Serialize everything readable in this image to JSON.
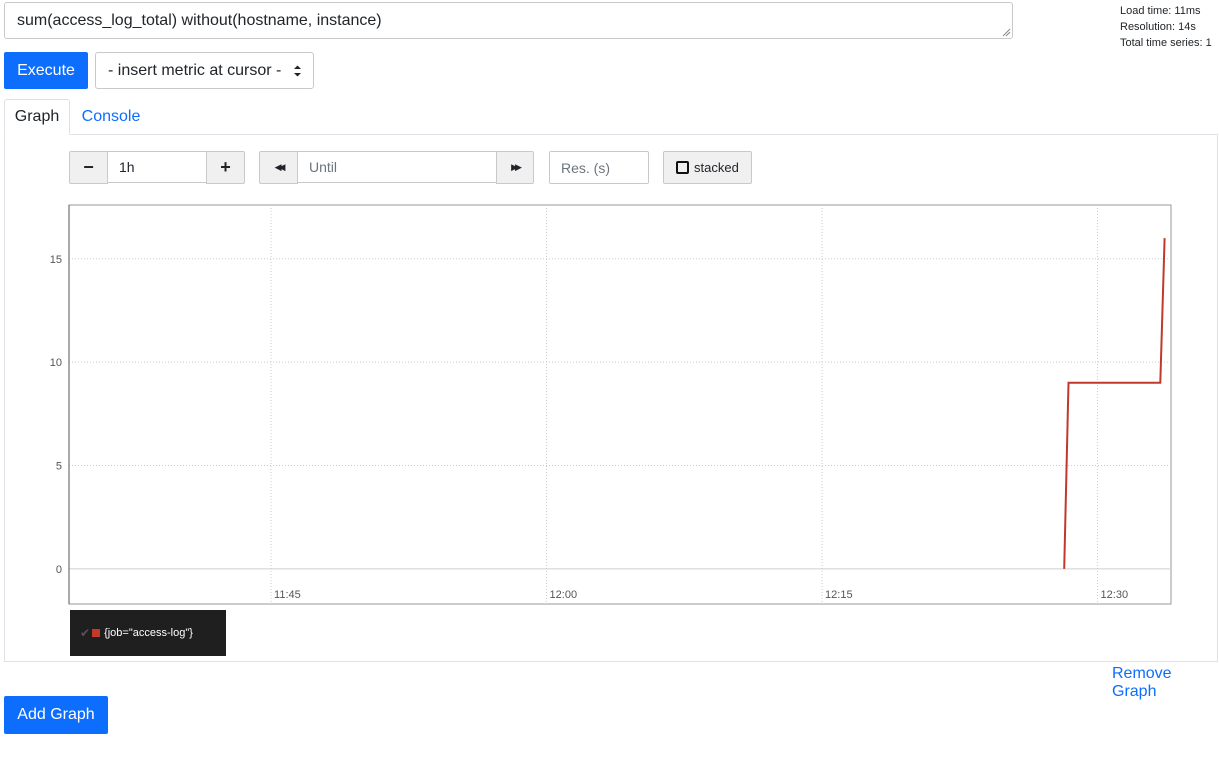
{
  "query": {
    "expression": "sum(access_log_total) without(hostname, instance)"
  },
  "stats": {
    "load_time": "Load time: 11ms",
    "resolution": "Resolution: 14s",
    "total_series": "Total time series: 1"
  },
  "toolbar": {
    "execute_label": "Execute",
    "metric_select_label": "- insert metric at cursor -"
  },
  "tabs": [
    {
      "label": "Graph",
      "active": true
    },
    {
      "label": "Console",
      "active": false
    }
  ],
  "graph_controls": {
    "minus_label": "−",
    "range_value": "1h",
    "plus_label": "+",
    "rewind_label": "◀◀",
    "until_placeholder": "Until",
    "forward_label": "▶▶",
    "resolution_placeholder": "Res. (s)",
    "stacked_label": "stacked"
  },
  "legend": {
    "check": "✔",
    "series_label": "{job=\"access-log\"}",
    "color": "#c0392b"
  },
  "actions": {
    "remove_graph_label": "Remove Graph",
    "add_graph_label": "Add Graph"
  },
  "colors": {
    "primary": "#0d6efd",
    "series": "#c0392b"
  },
  "chart_data": {
    "type": "line",
    "title": "",
    "xlabel": "",
    "ylabel": "",
    "x_ticks": [
      "11:45",
      "12:00",
      "12:15",
      "12:30"
    ],
    "y_ticks": [
      0,
      5,
      10,
      15
    ],
    "ylim": [
      -1.7,
      17.6
    ],
    "xlim": [
      "11:34",
      "12:34"
    ],
    "grid": true,
    "legend_position": "bottom-left",
    "series": [
      {
        "name": "{job=\"access-log\"}",
        "points": [
          {
            "x": "12:28:11",
            "y": 0
          },
          {
            "x": "12:28:25",
            "y": 9
          },
          {
            "x": "12:33:25",
            "y": 9
          },
          {
            "x": "12:33:39",
            "y": 16
          }
        ]
      }
    ]
  }
}
